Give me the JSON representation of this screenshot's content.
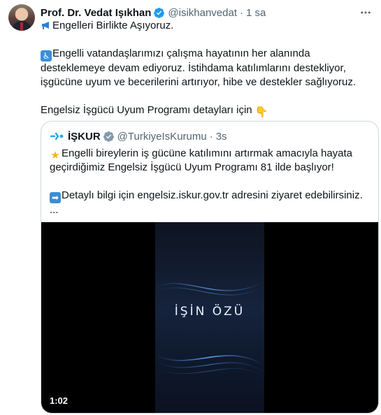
{
  "author": {
    "name": "Prof. Dr. Vedat Işıkhan",
    "handle": "@isikhanvedat",
    "separator": "·",
    "time": "1 sa"
  },
  "tweet": {
    "line1": "Engelleri Birlikte Aşıyoruz.",
    "para2": "Engelli vatandaşlarımızı çalışma hayatının her alanında desteklemeye devam ediyoruz. İstihdama katılımlarını destekliyor, işgücüne uyum ve becerilerini artırıyor, hibe ve destekler sağlıyoruz.",
    "para3": "Engelsiz İşgücü Uyum Programı detayları için"
  },
  "quoted": {
    "name": "İŞKUR",
    "handle": "@TurkiyeIsKurumu",
    "separator": "·",
    "time": "3s",
    "para1": "Engelli bireylerin iş gücüne katılımını artırmak amacıyla hayata geçirdiğimiz Engelsiz İşgücü Uyum Programı 81 ilde başlıyor!",
    "para2": "Detaylı bilgi için engelsiz.iskur.gov.tr adresini ziyaret edebilirsiniz.",
    "ellipsis": "...",
    "video": {
      "logo_text": "İŞİN ÖZÜ",
      "duration": "1:02"
    }
  },
  "icons": {
    "verified": "verified-badge-icon",
    "more": "more-options-icon",
    "megaphone": "megaphone-icon",
    "wheelchair": "wheelchair-icon",
    "pointing_down": "pointing-down-icon",
    "glowing_star": "glowing-star-icon",
    "arrow_right": "arrow-right-icon"
  },
  "colors": {
    "verified_blue": "#1d9bf0",
    "secondary_text": "#536471",
    "border": "#cfd9de"
  }
}
